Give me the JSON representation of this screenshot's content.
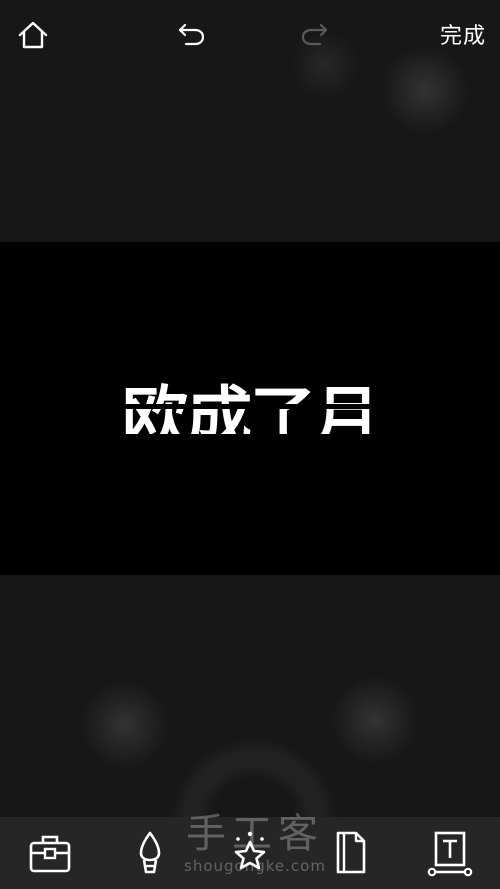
{
  "header": {
    "home_icon": "home-icon",
    "undo_icon": "undo-icon",
    "redo_icon": "redo-icon",
    "done_label": "完成"
  },
  "canvas": {
    "text": "欧成了月"
  },
  "toolbar": {
    "tools": [
      {
        "icon": "briefcase-icon"
      },
      {
        "icon": "brush-icon"
      },
      {
        "icon": "sparkle-star-icon"
      },
      {
        "icon": "page-icon"
      },
      {
        "icon": "text-box-icon"
      }
    ]
  },
  "watermark": {
    "title": "手工客",
    "subtitle": "shougongke.com"
  }
}
